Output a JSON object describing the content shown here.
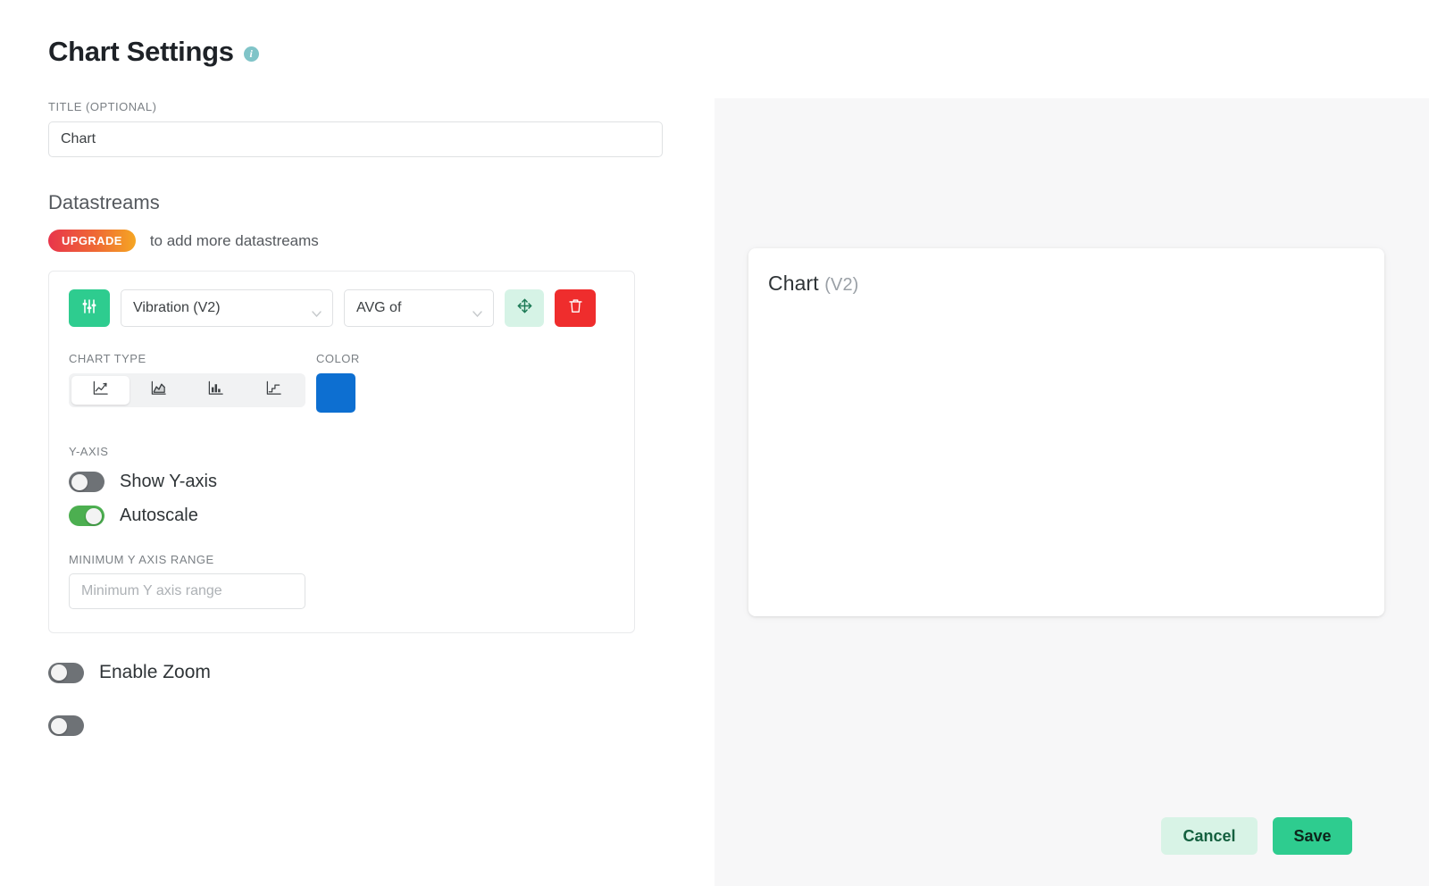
{
  "page": {
    "title": "Chart Settings",
    "info_icon": "info-icon",
    "title_field_label": "TITLE (OPTIONAL)",
    "title_field_value": "Chart",
    "title_field_placeholder": "Title"
  },
  "datastreams": {
    "heading": "Datastreams",
    "upgrade_badge": "UPGRADE",
    "upgrade_text": "to add more datastreams",
    "accent_green": "#2ecc8f",
    "accent_red": "#ef2d2d",
    "row": {
      "settings_icon": "sliders-icon",
      "source_value": "Vibration (V2)",
      "aggregate_value": "AVG of",
      "move_icon": "move-icon",
      "delete_icon": "trash-icon"
    },
    "chart_type": {
      "label": "CHART TYPE",
      "options": [
        {
          "name": "line-chart-icon",
          "selected": true
        },
        {
          "name": "area-chart-icon",
          "selected": false
        },
        {
          "name": "bar-chart-icon",
          "selected": false
        },
        {
          "name": "step-chart-icon",
          "selected": false
        }
      ]
    },
    "color": {
      "label": "COLOR",
      "value": "#0d6fd1"
    },
    "yaxis": {
      "label": "Y-AXIS",
      "show_yaxis_label": "Show Y-axis",
      "show_yaxis_on": false,
      "autoscale_label": "Autoscale",
      "autoscale_on": true,
      "min_range_label": "MINIMUM Y AXIS RANGE",
      "min_range_value": "",
      "min_range_placeholder": "Minimum Y axis range"
    }
  },
  "options": {
    "enable_zoom_label": "Enable Zoom",
    "enable_zoom_on": false
  },
  "preview": {
    "card_title": "Chart",
    "card_version": "(V2)"
  },
  "footer": {
    "cancel_label": "Cancel",
    "save_label": "Save"
  },
  "chart_data": {
    "type": "line",
    "title": "Chart",
    "series": [
      {
        "name": "Vibration (V2)",
        "aggregate": "AVG of",
        "color": "#0d6fd1",
        "values": []
      }
    ],
    "x": [],
    "categories": [],
    "xlabel": "",
    "ylabel": "",
    "grid": false,
    "legend": "none",
    "yaxis_visible": false,
    "autoscale": true
  }
}
